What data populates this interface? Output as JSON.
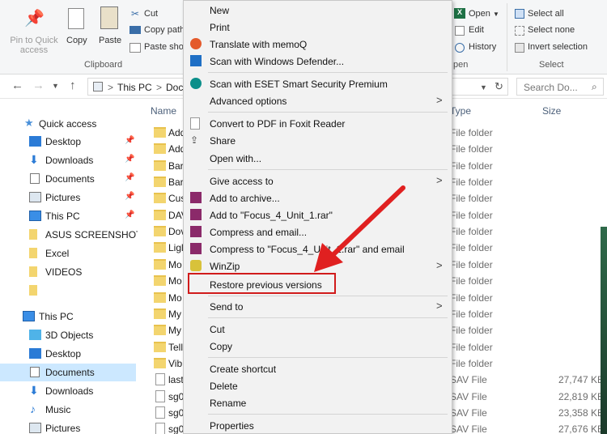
{
  "ribbon": {
    "pin_label": "Pin to Quick access",
    "copy_label": "Copy",
    "paste_label": "Paste",
    "cut_label": "Cut",
    "copy_path_label": "Copy path",
    "paste_shortcut_label": "Paste sho",
    "clipboard_group": "Clipboard",
    "open_label": "Open",
    "edit_label": "Edit",
    "history_label": "History",
    "open_group": "pen",
    "select_all_label": "Select all",
    "select_none_label": "Select none",
    "invert_selection_label": "Invert selection",
    "select_group": "Select"
  },
  "address": {
    "this_pc": "This PC",
    "separator": ">",
    "doc_crumb": "Doc",
    "search_placeholder": "Search Do..."
  },
  "nav": {
    "quick_access": "Quick access",
    "items": [
      {
        "label": "Desktop"
      },
      {
        "label": "Downloads"
      },
      {
        "label": "Documents"
      },
      {
        "label": "Pictures"
      },
      {
        "label": "This PC"
      },
      {
        "label": "ASUS SCREENSHOTS"
      },
      {
        "label": "Excel"
      },
      {
        "label": "VIDEOS"
      },
      {
        "label": ""
      }
    ],
    "this_pc_section": "This PC",
    "pc_items": [
      {
        "label": "3D Objects"
      },
      {
        "label": "Desktop"
      },
      {
        "label": "Documents"
      },
      {
        "label": "Downloads"
      },
      {
        "label": "Music"
      },
      {
        "label": "Pictures"
      }
    ]
  },
  "files": {
    "col_name": "Name",
    "col_type": "Type",
    "col_size": "Size",
    "rows": [
      {
        "name": "Add",
        "type": "File folder",
        "size": ""
      },
      {
        "name": "Add",
        "type": "File folder",
        "size": ""
      },
      {
        "name": "Bar",
        "type": "File folder",
        "size": ""
      },
      {
        "name": "Bar",
        "type": "File folder",
        "size": ""
      },
      {
        "name": "Cus",
        "type": "File folder",
        "size": ""
      },
      {
        "name": "DAV",
        "type": "File folder",
        "size": ""
      },
      {
        "name": "Dov",
        "type": "File folder",
        "size": ""
      },
      {
        "name": "Ligl",
        "type": "File folder",
        "size": ""
      },
      {
        "name": "Mo",
        "type": "File folder",
        "size": ""
      },
      {
        "name": "Mo",
        "type": "File folder",
        "size": ""
      },
      {
        "name": "Mo",
        "type": "File folder",
        "size": ""
      },
      {
        "name": "My",
        "type": "File folder",
        "size": ""
      },
      {
        "name": "My",
        "type": "File folder",
        "size": ""
      },
      {
        "name": "Tell",
        "type": "File folder",
        "size": ""
      },
      {
        "name": "Vib",
        "type": "File folder",
        "size": ""
      },
      {
        "name": "last",
        "type": "SAV File",
        "size": "27,747 KB"
      },
      {
        "name": "sg0",
        "type": "SAV File",
        "size": "22,819 KB"
      },
      {
        "name": "sg0",
        "type": "SAV File",
        "size": "23,358 KB"
      },
      {
        "name": "sg0",
        "type": "SAV File",
        "size": "27,676 KB"
      }
    ]
  },
  "menu": {
    "new": "New",
    "print": "Print",
    "translate": "Translate with memoQ",
    "scan_defender": "Scan with Windows Defender...",
    "scan_eset": "Scan with ESET Smart Security Premium",
    "advanced": "Advanced options",
    "convert_pdf": "Convert to PDF in Foxit Reader",
    "share": "Share",
    "open_with": "Open with...",
    "give_access": "Give access to",
    "add_archive": "Add to archive...",
    "add_rar": "Add to \"Focus_4_Unit_1.rar\"",
    "compress_email": "Compress and email...",
    "compress_to": "Compress to \"Focus_4_Unit_1.rar\" and email",
    "winzip": "WinZip",
    "restore": "Restore previous versions",
    "send_to": "Send to",
    "cut": "Cut",
    "copy": "Copy",
    "create_shortcut": "Create shortcut",
    "delete": "Delete",
    "rename": "Rename",
    "properties": "Properties",
    "submenu_arrow": ">"
  },
  "colors": {
    "highlight_box": "#d11b1b",
    "arrow": "#e02020",
    "selection": "#cce8ff"
  }
}
